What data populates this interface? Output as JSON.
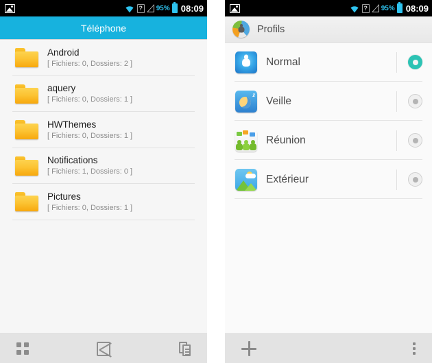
{
  "statusbar": {
    "photo_icon": "photo-icon",
    "wifi_icon": "wifi-icon",
    "sim_icon_label": "?",
    "signal_icon": "signal-icon",
    "battery_percent": "95%",
    "battery_icon": "battery-icon",
    "time": "08:09"
  },
  "left_screen": {
    "title": "Téléphone",
    "files": [
      {
        "name": "Android",
        "meta": "[ Fichiers: 0, Dossiers: 2 ]",
        "icon": "folder-icon"
      },
      {
        "name": "aquery",
        "meta": "[ Fichiers: 0, Dossiers: 1 ]",
        "icon": "folder-icon"
      },
      {
        "name": "HWThemes",
        "meta": "[ Fichiers: 0, Dossiers: 1 ]",
        "icon": "folder-icon"
      },
      {
        "name": "Notifications",
        "meta": "[ Fichiers: 1, Dossiers: 0 ]",
        "icon": "folder-icon"
      },
      {
        "name": "Pictures",
        "meta": "[ Fichiers: 0, Dossiers: 1 ]",
        "icon": "folder-icon"
      }
    ],
    "toolbar": {
      "grid_icon": "grid-view-icon",
      "cut_icon": "cut-icon",
      "copy_icon": "copy-paste-icon"
    }
  },
  "right_screen": {
    "title": "Profils",
    "title_icon": "profiles-icon",
    "profiles": [
      {
        "label": "Normal",
        "icon": "person-icon",
        "selected": true
      },
      {
        "label": "Veille",
        "icon": "moon-sleep-icon",
        "selected": false
      },
      {
        "label": "Réunion",
        "icon": "meeting-people-icon",
        "selected": false
      },
      {
        "label": "Extérieur",
        "icon": "landscape-icon",
        "selected": false
      }
    ],
    "toolbar": {
      "add_icon": "plus-icon",
      "overflow_icon": "overflow-menu-icon"
    }
  },
  "colors": {
    "header_blue": "#17b2de",
    "accent_teal": "#2cc3b4",
    "status_cyan": "#2ec3ef",
    "folder_yellow": "#fcc434",
    "list_bg": "#f6f6f6"
  }
}
